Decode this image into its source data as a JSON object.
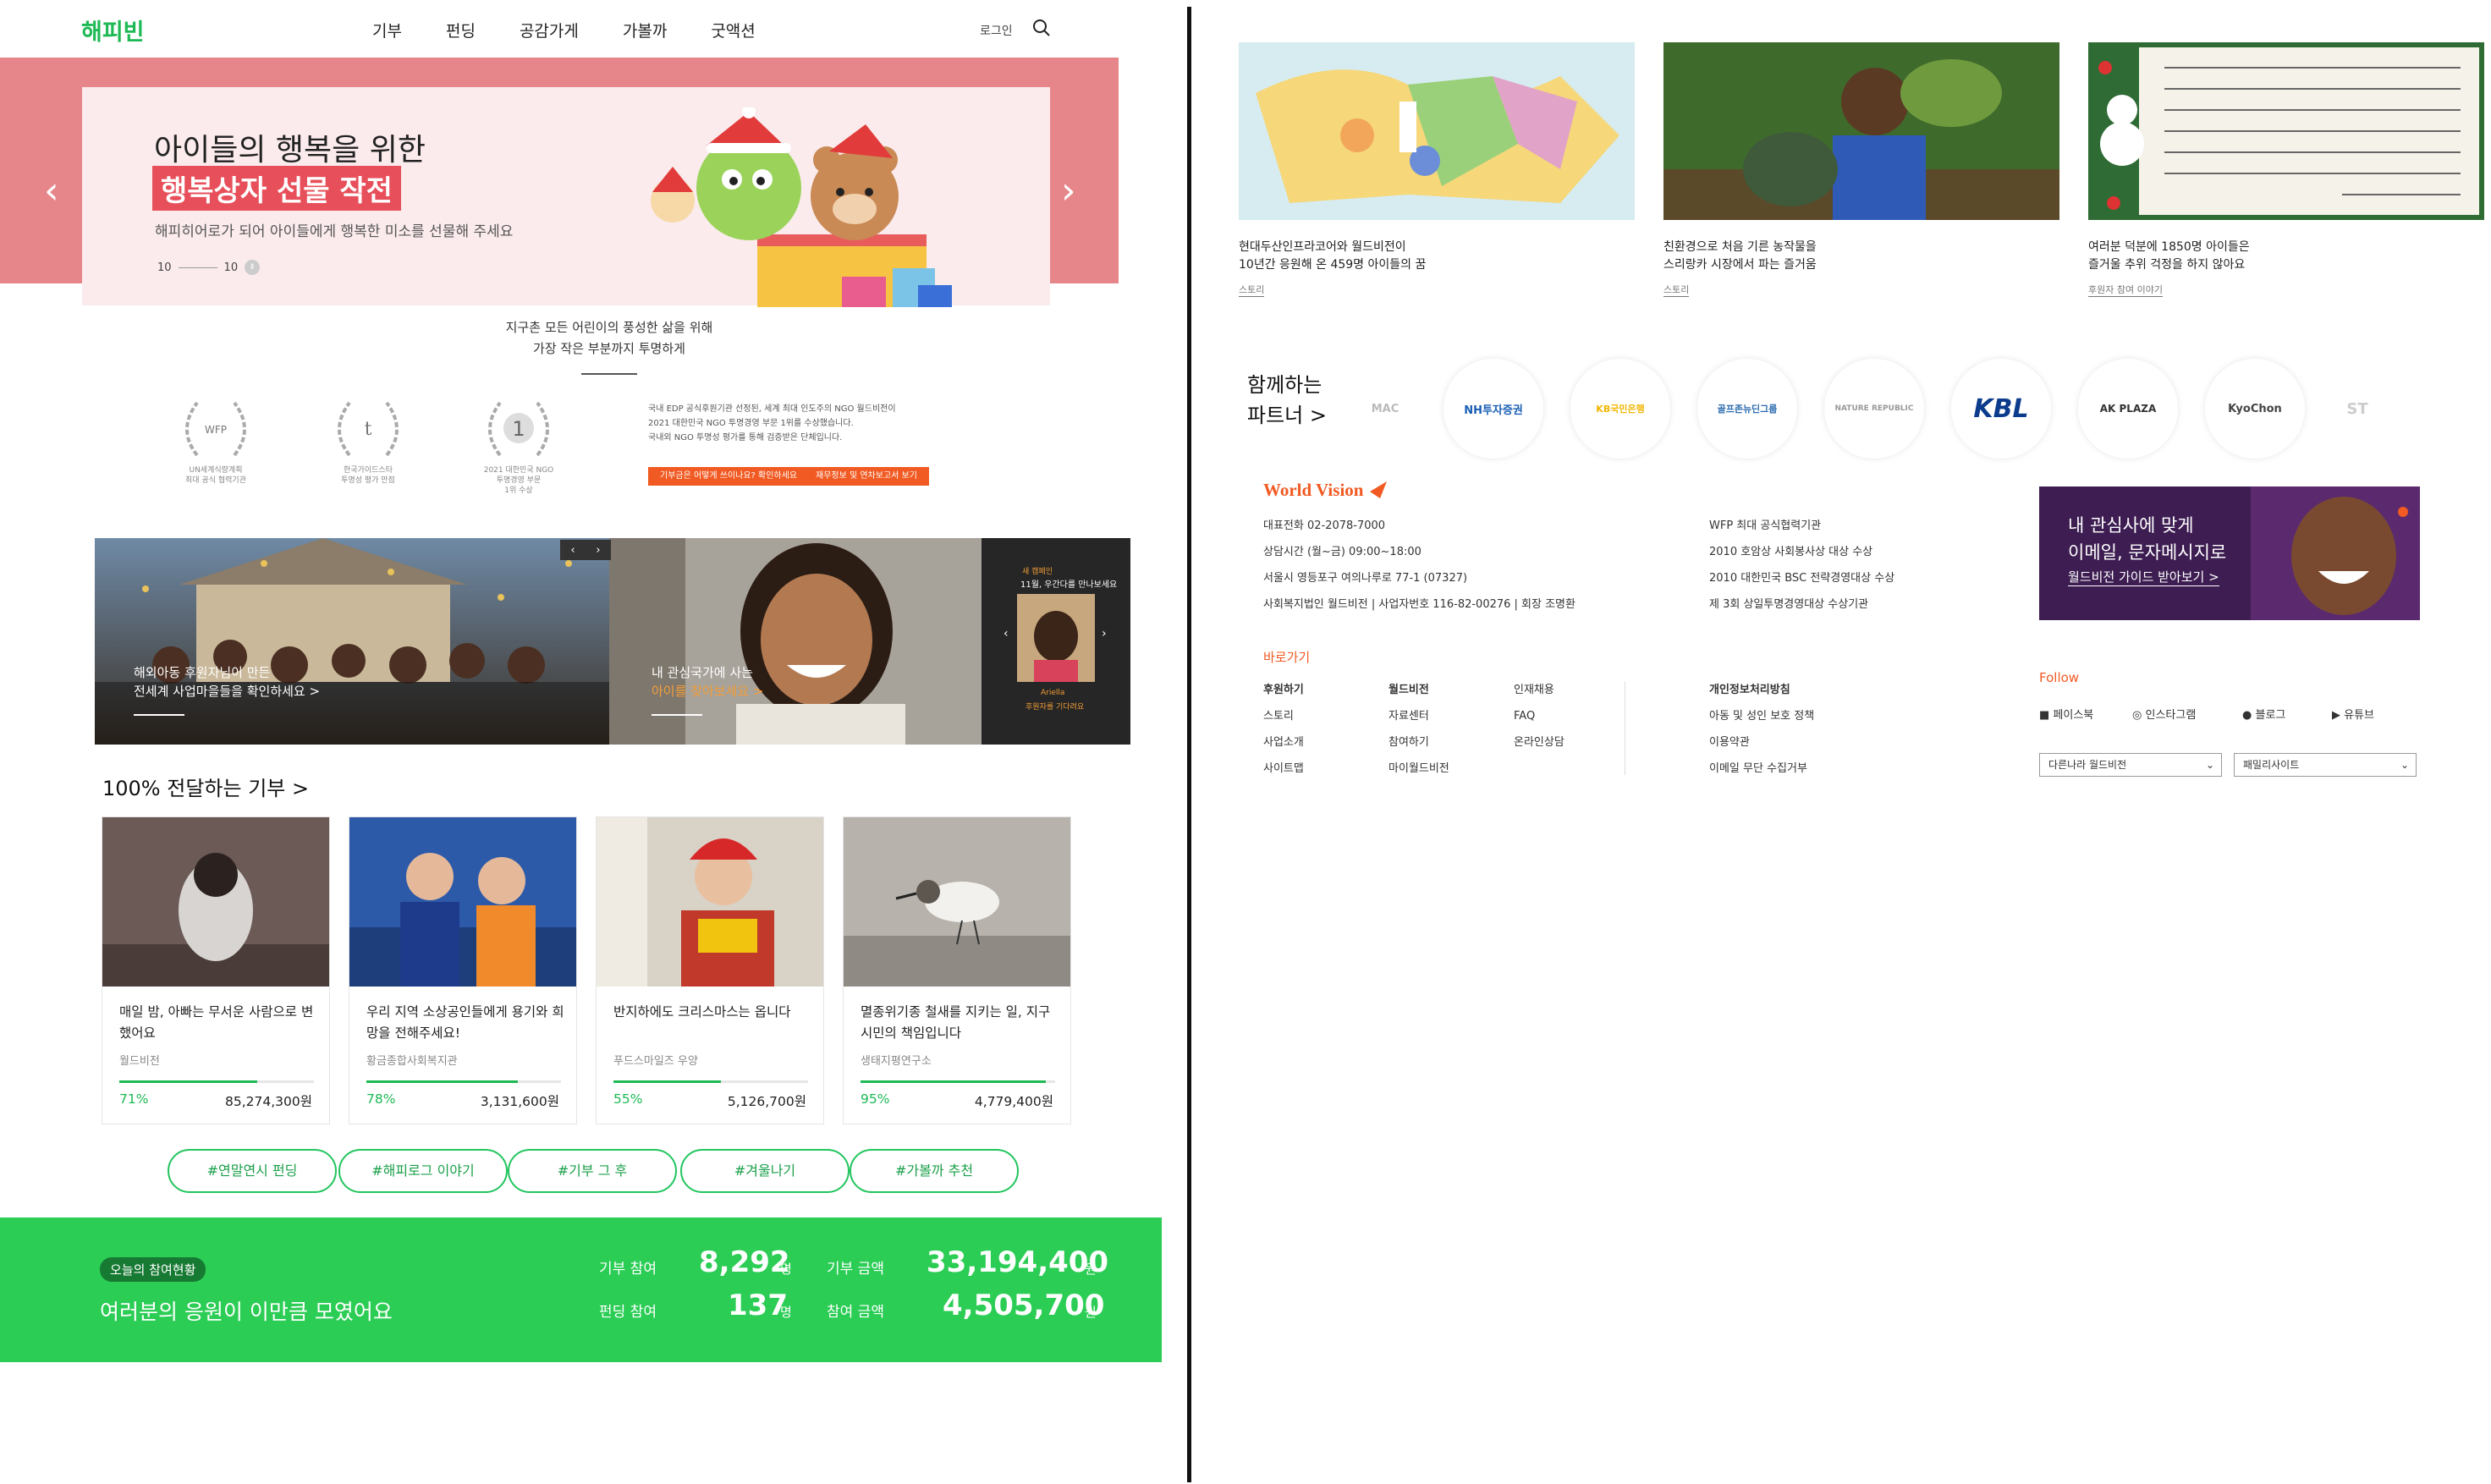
{
  "happybean": {
    "logo": "해피빈",
    "nav": [
      "기부",
      "펀딩",
      "공감가게",
      "가볼까",
      "굿액션"
    ],
    "login": "로그인",
    "hero": {
      "title1": "아이들의 행복을 위한",
      "title2": "행복상자 선물 작전",
      "subtitle": "해피히어로가 되어 아이들에게 행복한 미소를 선물해 주세요",
      "pager_current": "10",
      "pager_total": "10"
    },
    "transparency": {
      "line1": "지구촌 모든 어린이의 풍성한 삶을 위해",
      "line2": "가장 작은 부분까지 투명하게"
    },
    "awards": [
      {
        "mark": "WFP",
        "caption": "UN세계식량계획\n최대 공식 협력기관"
      },
      {
        "mark": "t",
        "caption": "한국가이드스타\n투명성 평가 만점"
      },
      {
        "mark": "1",
        "caption": "2021 대한민국 NGO\n투명경영 부문\n1위 수상"
      }
    ],
    "wfp_text": [
      "국내 EDP 공식후원기관 선정된, 세계 최대 인도주의 NGO 월드비전이",
      "2021 대한민국 NGO 투명경영 부문 1위를 수상했습니다.",
      "국내외 NGO 투명성 평가를 통해 검증받은 단체입니다."
    ],
    "wfp_buttons": [
      "기부금은 어떻게 쓰이나요? 확인하세요",
      "재무정보 및 연차보고서 보기"
    ],
    "promo": {
      "cap1_line1": "해외아동 후원자님이 만든",
      "cap1_line2": "전세계 사업마을들을 확인하세요 >",
      "cap2_line1": "내 관심국가에 사는",
      "cap2_line2": "아이를 찾아보세요 >",
      "side_tag": "새 캠페인",
      "side_title": "11월, 우간다를 만나보세요",
      "side_child": "Ariella",
      "side_child_sub": "후원자를 기다려요"
    },
    "section_title": "100% 전달하는 기부 >",
    "cards": [
      {
        "title": "매일 밤, 아빠는 무서운 사람으로 변했어요",
        "org": "월드비전",
        "percent": 71,
        "percent_label": "71%",
        "amount": "85,274,300원"
      },
      {
        "title": "우리 지역 소상공인들에게 용기와 희망을 전해주세요!",
        "org": "황금종합사회복지관",
        "percent": 78,
        "percent_label": "78%",
        "amount": "3,131,600원"
      },
      {
        "title": "반지하에도 크리스마스는 옵니다",
        "org": "푸드스마일즈 우양",
        "percent": 55,
        "percent_label": "55%",
        "amount": "5,126,700원"
      },
      {
        "title": "멸종위기종 철새를 지키는 일, 지구시민의 책임입니다",
        "org": "생태지평연구소",
        "percent": 95,
        "percent_label": "95%",
        "amount": "4,779,400원"
      }
    ],
    "tags": [
      "#연말연시 펀딩",
      "#해피로그 이야기",
      "#기부 그 후",
      "#겨울나기",
      "#가볼까 추천"
    ],
    "stats": {
      "badge": "오늘의 참여현황",
      "headline": "여러분의 응원이 이만큼 모였어요",
      "donate_count_label": "기부 참여",
      "donate_count": "8,292",
      "donate_count_unit": "명",
      "donate_amount_label": "기부 금액",
      "donate_amount": "33,194,400",
      "donate_amount_unit": "원",
      "fund_count_label": "펀딩 참여",
      "fund_count": "137",
      "fund_count_unit": "명",
      "fund_amount_label": "참여 금액",
      "fund_amount": "4,505,700",
      "fund_amount_unit": "원"
    }
  },
  "worldvision": {
    "stories": [
      {
        "title1": "현대두산인프라코어와 월드비전이",
        "title2": "10년간 응원해 온 459명 아이들의 꿈",
        "category": "스토리"
      },
      {
        "title1": "친환경으로 처음 기른 농작물을",
        "title2": "스리랑카 시장에서 파는 즐거움",
        "category": "스토리"
      },
      {
        "title1": "여러분 덕분에 1850명 아이들은",
        "title2": "즐거울 추위 걱정을 하지 않아요",
        "category": "후원자 참여 이야기"
      }
    ],
    "partners_title1": "함께하는",
    "partners_title2": "파트너 >",
    "partners": [
      {
        "name": "MAC",
        "color": "#bbbbbb"
      },
      {
        "name": "NH투자증권",
        "color": "#1a5fb4"
      },
      {
        "name": "KB국민은행",
        "color": "#f2b705"
      },
      {
        "name": "골프존뉴딘그룹",
        "color": "#2b6cb0"
      },
      {
        "name": "NATURE REPUBLIC",
        "color": "#999999"
      },
      {
        "name": "KBL",
        "color": "#0b3b8c"
      },
      {
        "name": "AK PLAZA",
        "color": "#333333"
      },
      {
        "name": "KyoChon",
        "color": "#444444"
      },
      {
        "name": "ST",
        "color": "#cccccc"
      }
    ],
    "brand": "World Vision",
    "contact": [
      "대표전화 02-2078-7000",
      "상담시간 (월~금) 09:00~18:00",
      "서울시 영등포구 여의나루로 77-1 (07327)",
      "사회복지법인 월드비전 | 사업자번호 116-82-00276 | 회장 조명환"
    ],
    "awards": [
      "WFP 최대 공식협력기관",
      "2010 호암상 사회봉사상 대상 수상",
      "2010 대한민국 BSC 전략경영대상 수상",
      "제 3회 상일투명경영대상 수상기관"
    ],
    "banner_line1": "내 관심사에 맞게",
    "banner_line2": "이메일, 문자메시지로",
    "banner_link": "월드비전 가이드 받아보기 >",
    "shortcut_title": "바로가기",
    "links_col1": [
      "후원하기",
      "스토리",
      "사업소개",
      "사이트맵"
    ],
    "links_col2": [
      "월드비전",
      "자료센터",
      "참여하기",
      "마이월드비전"
    ],
    "links_col3": [
      "인재채용",
      "FAQ",
      "온라인상담"
    ],
    "links_col4": [
      "개인정보처리방침",
      "아동 및 성인 보호 정책",
      "이용약관",
      "이메일 무단 수집거부"
    ],
    "follow": "Follow",
    "sns": [
      "페이스북",
      "인스타그램",
      "블로그",
      "유튜브"
    ],
    "select1": "다른나라 월드비전",
    "select2": "패밀리사이트"
  }
}
